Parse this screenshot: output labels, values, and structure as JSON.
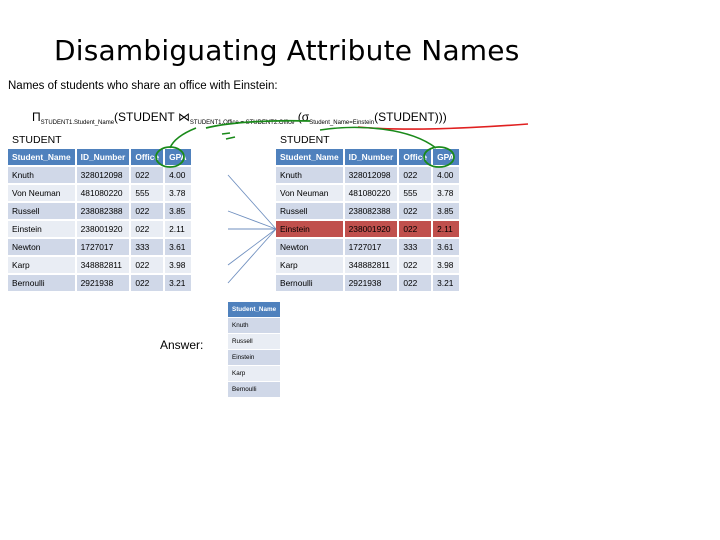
{
  "title": "Disambiguating Attribute Names",
  "subtitle": "Names of students who share an office with Einstein:",
  "expression": {
    "pi": "Π",
    "pi_sub": "STUDENT1.Student_Name",
    "part1": "(STUDENT ",
    "join": "⋈",
    "join_sub": "STUDENT1.Office = STUDENT2.Office",
    "part2": " (σ",
    "sigma_sub": "Student_Name=Einstein",
    "part3": "(STUDENT)))"
  },
  "left_table": {
    "label": "STUDENT",
    "columns": [
      "Student_Name",
      "ID_Number",
      "Office",
      "GPA"
    ],
    "rows": [
      [
        "Knuth",
        "328012098",
        "022",
        "4.00"
      ],
      [
        "Von Neuman",
        "481080220",
        "555",
        "3.78"
      ],
      [
        "Russell",
        "238082388",
        "022",
        "3.85"
      ],
      [
        "Einstein",
        "238001920",
        "022",
        "2.11"
      ],
      [
        "Newton",
        "1727017",
        "333",
        "3.61"
      ],
      [
        "Karp",
        "348882811",
        "022",
        "3.98"
      ],
      [
        "Bernoulli",
        "2921938",
        "022",
        "3.21"
      ]
    ]
  },
  "right_table": {
    "label": "STUDENT",
    "columns": [
      "Student_Name",
      "ID_Number",
      "Office",
      "GPA"
    ],
    "highlight_row": 3,
    "highlight_color": "#c0504d",
    "rows": [
      [
        "Knuth",
        "328012098",
        "022",
        "4.00"
      ],
      [
        "Von Neuman",
        "481080220",
        "555",
        "3.78"
      ],
      [
        "Russell",
        "238082388",
        "022",
        "3.85"
      ],
      [
        "Einstein",
        "238001920",
        "022",
        "2.11"
      ],
      [
        "Newton",
        "1727017",
        "333",
        "3.61"
      ],
      [
        "Karp",
        "348882811",
        "022",
        "3.98"
      ],
      [
        "Bernoulli",
        "2921938",
        "022",
        "3.21"
      ]
    ]
  },
  "answer": {
    "label": "Answer:",
    "column": "Student_Name",
    "rows": [
      "Knuth",
      "Russell",
      "Einstein",
      "Karp",
      "Bernoulli"
    ]
  },
  "colors": {
    "header": "#4f81bd",
    "row_dark": "#d0d8e8",
    "row_light": "#e9edf4",
    "annotation_green": "#1a8a1a",
    "annotation_red": "#e02020",
    "connector": "#6f8fbf"
  }
}
